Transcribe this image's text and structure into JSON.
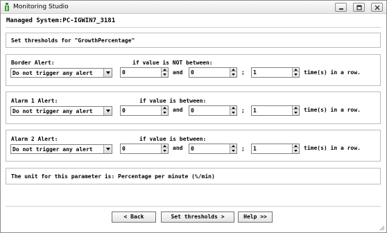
{
  "window": {
    "title": "Monitoring Studio"
  },
  "managed_system": "Managed System:PC-IGWIN7_3181",
  "header": {
    "text": "Set thresholds for \"GrowthPercentage\""
  },
  "alerts": [
    {
      "label": "Border Alert:",
      "condition": "if value is NOT between:",
      "trigger": "Do not trigger any alert",
      "low": "0",
      "high": "0",
      "times": "1"
    },
    {
      "label": "Alarm 1 Alert:",
      "condition": "if value is between:",
      "trigger": "Do not trigger any alert",
      "low": "0",
      "high": "0",
      "times": "1"
    },
    {
      "label": "Alarm 2 Alert:",
      "condition": "if value is between:",
      "trigger": "Do not trigger any alert",
      "low": "0",
      "high": "0",
      "times": "1"
    }
  ],
  "common": {
    "and": "and",
    "semicolon": ";",
    "times_suffix": "time(s) in a row."
  },
  "unit_text": "The unit for this parameter is: Percentage per minute (%/min)",
  "buttons": {
    "back": "< Back",
    "set": "Set thresholds >",
    "help": "Help >>"
  }
}
